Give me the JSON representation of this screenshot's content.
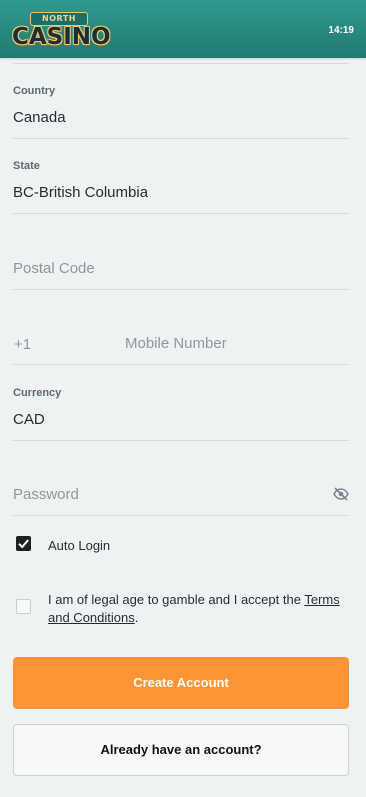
{
  "header": {
    "logo_small": "NORTH",
    "logo_big": "CASINO",
    "time": "14:19"
  },
  "form": {
    "country": {
      "label": "Country",
      "value": "Canada"
    },
    "state": {
      "label": "State",
      "value": "BC-British Columbia"
    },
    "postal_code": {
      "placeholder": "Postal Code"
    },
    "mobile": {
      "prefix": "+1",
      "placeholder": "Mobile Number"
    },
    "currency": {
      "label": "Currency",
      "value": "CAD"
    },
    "password": {
      "placeholder": "Password"
    },
    "auto_login": {
      "label": "Auto Login",
      "checked": true
    },
    "terms": {
      "text_before": "I am of legal age to gamble and I accept the ",
      "link_line1": "Terms",
      "link_line2": "and Conditions",
      "text_after": ".",
      "checked": false
    }
  },
  "buttons": {
    "create_account": "Create Account",
    "already_have_account": "Already have an account?"
  },
  "colors": {
    "header_bg": "#2f9a8e",
    "accent_orange": "#fd9537"
  }
}
